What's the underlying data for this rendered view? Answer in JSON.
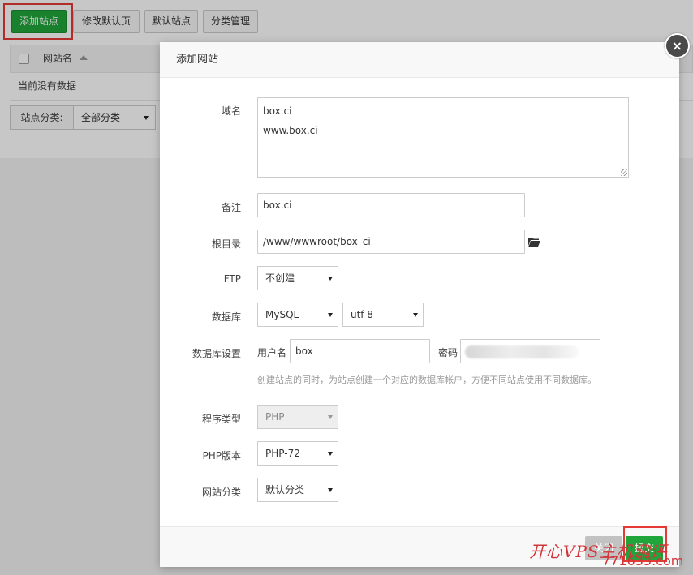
{
  "toolbar": {
    "add_site": "添加站点",
    "edit_default": "修改默认页",
    "default_site": "默认站点",
    "category_manage": "分类管理"
  },
  "site_list": {
    "col_name": "网站名",
    "empty": "当前没有数据",
    "category_label": "站点分类:",
    "category_value": "全部分类"
  },
  "modal": {
    "title": "添加网站",
    "domain_label": "域名",
    "domain_lines": [
      "box.ci",
      "www.box.ci"
    ],
    "note_label": "备注",
    "note_value": "box.ci",
    "root_label": "根目录",
    "root_value": "/www/wwwroot/box_ci",
    "ftp_label": "FTP",
    "ftp_value": "不创建",
    "db_label": "数据库",
    "db_value": "MySQL",
    "charset_value": "utf-8",
    "db_settings_label": "数据库设置",
    "db_user_label": "用户名",
    "db_user_value": "box",
    "db_pass_label": "密码",
    "db_tip": "创建站点的同时，为站点创建一个对应的数据库帐户，方便不同站点使用不同数据库。",
    "program_label": "程序类型",
    "program_value": "PHP",
    "php_label": "PHP版本",
    "php_value": "PHP-72",
    "site_cat_label": "网站分类",
    "site_cat_value": "默认分类",
    "close_btn": "关闭",
    "submit_btn": "提交",
    "close_icon": "×"
  },
  "watermark": {
    "text": "开心VPS主机测评",
    "sub": "771633.com"
  },
  "colors": {
    "primary_green": "#20a53a",
    "highlight_red": "#e53935",
    "watermark_red": "#d0353a"
  },
  "icons": [
    "close-icon",
    "folder-open-icon",
    "sort-up-icon",
    "chevron-down-icon"
  ]
}
